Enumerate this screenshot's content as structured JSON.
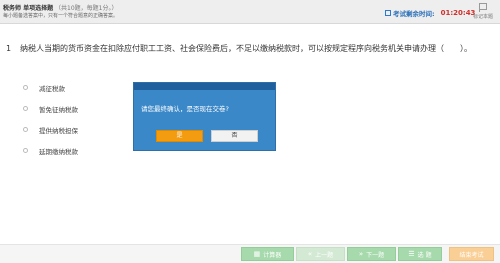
{
  "header": {
    "title_main": "税务师 单项选择题",
    "title_sub": "（共10题，每题1分。）",
    "note": "每小题备选答案中，只有一个符合题意的正确答案。",
    "timer_label": "考试剩余时间:",
    "timer_value": "01:20:43",
    "bookmark_label": "标记本题"
  },
  "question": {
    "number": "1",
    "text": "纳税人当期的货币资金在扣除应付职工工资、社会保险费后，不足以缴纳税款时，可以按规定程序向税务机关申请办理（　　）。",
    "options": [
      {
        "label": "减征税款"
      },
      {
        "label": "暂免征纳税款"
      },
      {
        "label": "提供纳税担保"
      },
      {
        "label": "延期缴纳税款"
      }
    ]
  },
  "modal": {
    "message": "请您最终确认，是否现在交卷?",
    "yes_label": "是",
    "no_label": "否"
  },
  "footer": {
    "calculator_label": "计算器",
    "prev_label": "上一题",
    "next_label": "下一题",
    "choose_label": "选 题",
    "submit_label": "结束考试"
  },
  "colors": {
    "modal_bg": "#3b88c9",
    "modal_header": "#1f5f9d",
    "yes_button": "#f39c12",
    "timer_value": "#d0302b",
    "footer_button": "#a6d9ac",
    "submit_button": "#f9cf96"
  }
}
